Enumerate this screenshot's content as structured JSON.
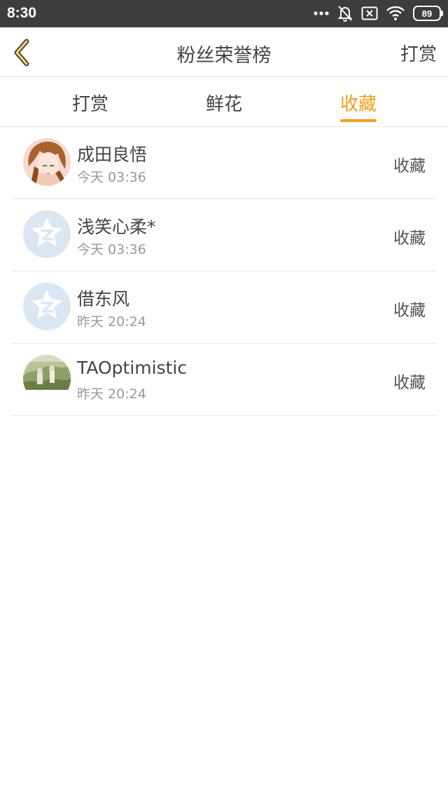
{
  "status_bar": {
    "time": "8:30",
    "battery": "89",
    "icons": [
      "more-dots-icon",
      "bell-off-icon",
      "sim-off-icon",
      "wifi-icon",
      "battery-icon"
    ]
  },
  "header": {
    "back_icon": "chevron-left-icon",
    "title": "粉丝荣誉榜",
    "action_label": "打赏"
  },
  "tabs": [
    {
      "label": "打赏",
      "active": false
    },
    {
      "label": "鲜花",
      "active": false
    },
    {
      "label": "收藏",
      "active": true
    }
  ],
  "colors": {
    "accent": "#f0a01a",
    "status_bar_bg": "#3d3d3d",
    "divider": "#e6e6e6",
    "default_avatar_bg": "#dbe6f3"
  },
  "fans": [
    {
      "name": "成田良悟",
      "time": "今天 03:36",
      "action": "收藏",
      "avatar": "photo-avatar-girl"
    },
    {
      "name": "浅笑心柔*",
      "time": "今天 03:36",
      "action": "收藏",
      "avatar": "default-qq-avatar"
    },
    {
      "name": "借东风",
      "time": "昨天 20:24",
      "action": "收藏",
      "avatar": "default-qq-avatar"
    },
    {
      "name": "TAOptimistic",
      "time": "昨天 20:24",
      "action": "收藏",
      "avatar": "photo-avatar-scene"
    }
  ]
}
